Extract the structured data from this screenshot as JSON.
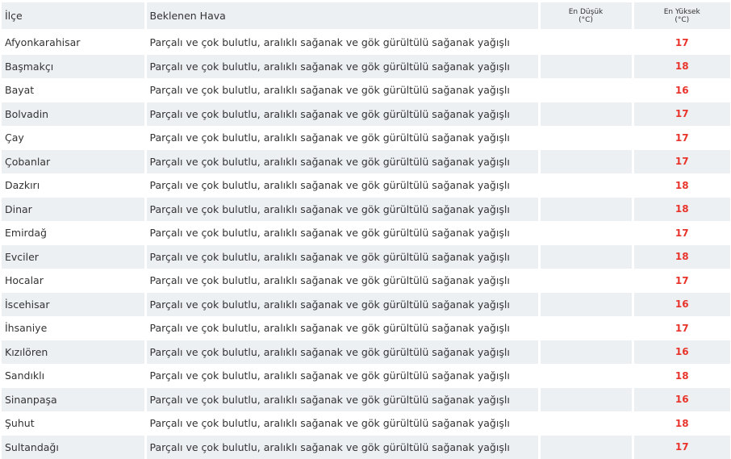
{
  "header": {
    "col_district": "İlçe",
    "col_weather": "Beklenen Hava",
    "col_min_line1": "En Düşük",
    "col_min_line2": "(°C)",
    "col_max_line1": "En Yüksek",
    "col_max_line2": "(°C)"
  },
  "accent_color": "#e8342b",
  "stripe_color": "#edf0f3",
  "rows": [
    {
      "district": "Afyonkarahisar",
      "weather": "Parçalı ve çok bulutlu, aralıklı sağanak ve gök gürültülü sağanak yağışlı",
      "min": "",
      "max": "17"
    },
    {
      "district": "Başmakçı",
      "weather": "Parçalı ve çok bulutlu, aralıklı sağanak ve gök gürültülü sağanak yağışlı",
      "min": "",
      "max": "18"
    },
    {
      "district": "Bayat",
      "weather": "Parçalı ve çok bulutlu, aralıklı sağanak ve gök gürültülü sağanak yağışlı",
      "min": "",
      "max": "16"
    },
    {
      "district": "Bolvadin",
      "weather": "Parçalı ve çok bulutlu, aralıklı sağanak ve gök gürültülü sağanak yağışlı",
      "min": "",
      "max": "17"
    },
    {
      "district": "Çay",
      "weather": "Parçalı ve çok bulutlu, aralıklı sağanak ve gök gürültülü sağanak yağışlı",
      "min": "",
      "max": "17"
    },
    {
      "district": "Çobanlar",
      "weather": "Parçalı ve çok bulutlu, aralıklı sağanak ve gök gürültülü sağanak yağışlı",
      "min": "",
      "max": "17"
    },
    {
      "district": "Dazkırı",
      "weather": "Parçalı ve çok bulutlu, aralıklı sağanak ve gök gürültülü sağanak yağışlı",
      "min": "",
      "max": "18"
    },
    {
      "district": "Dinar",
      "weather": "Parçalı ve çok bulutlu, aralıklı sağanak ve gök gürültülü sağanak yağışlı",
      "min": "",
      "max": "18"
    },
    {
      "district": "Emirdağ",
      "weather": "Parçalı ve çok bulutlu, aralıklı sağanak ve gök gürültülü sağanak yağışlı",
      "min": "",
      "max": "17"
    },
    {
      "district": "Evciler",
      "weather": "Parçalı ve çok bulutlu, aralıklı sağanak ve gök gürültülü sağanak yağışlı",
      "min": "",
      "max": "18"
    },
    {
      "district": "Hocalar",
      "weather": "Parçalı ve çok bulutlu, aralıklı sağanak ve gök gürültülü sağanak yağışlı",
      "min": "",
      "max": "17"
    },
    {
      "district": "İscehisar",
      "weather": "Parçalı ve çok bulutlu, aralıklı sağanak ve gök gürültülü sağanak yağışlı",
      "min": "",
      "max": "16"
    },
    {
      "district": "İhsaniye",
      "weather": "Parçalı ve çok bulutlu, aralıklı sağanak ve gök gürültülü sağanak yağışlı",
      "min": "",
      "max": "17"
    },
    {
      "district": "Kızılören",
      "weather": "Parçalı ve çok bulutlu, aralıklı sağanak ve gök gürültülü sağanak yağışlı",
      "min": "",
      "max": "16"
    },
    {
      "district": "Sandıklı",
      "weather": "Parçalı ve çok bulutlu, aralıklı sağanak ve gök gürültülü sağanak yağışlı",
      "min": "",
      "max": "18"
    },
    {
      "district": "Sinanpaşa",
      "weather": "Parçalı ve çok bulutlu, aralıklı sağanak ve gök gürültülü sağanak yağışlı",
      "min": "",
      "max": "16"
    },
    {
      "district": "Şuhut",
      "weather": "Parçalı ve çok bulutlu, aralıklı sağanak ve gök gürültülü sağanak yağışlı",
      "min": "",
      "max": "18"
    },
    {
      "district": "Sultandağı",
      "weather": "Parçalı ve çok bulutlu, aralıklı sağanak ve gök gürültülü sağanak yağışlı",
      "min": "",
      "max": "17"
    }
  ]
}
